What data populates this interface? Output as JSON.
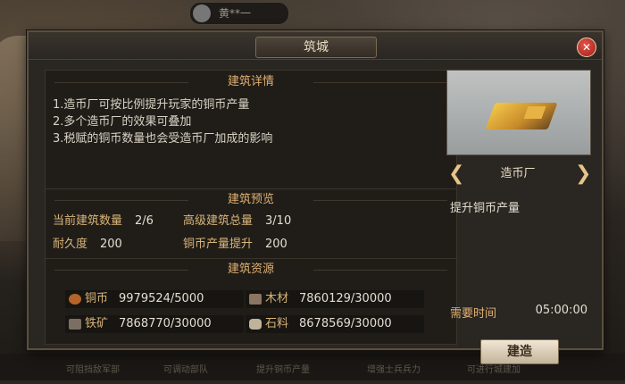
{
  "scene": {
    "player_name": "黄**一",
    "bottom_hints": [
      "可阻挡敌军部",
      "可调动部队",
      "提升铜币产量",
      "增强士兵兵力",
      "可进行城建加"
    ]
  },
  "modal": {
    "title": "筑城",
    "close": "✕"
  },
  "detail": {
    "heading": "建筑详情",
    "lines": [
      "1.造币厂可按比例提升玩家的铜币产量",
      "2.多个造币厂的效果可叠加",
      "3.税赋的铜币数量也会受造币厂加成的影响"
    ]
  },
  "preview": {
    "heading": "建筑预览",
    "items": [
      {
        "label": "当前建筑数量",
        "value": "2/6"
      },
      {
        "label": "高级建筑总量",
        "value": "3/10"
      },
      {
        "label": "耐久度",
        "value": "200"
      },
      {
        "label": "铜币产量提升",
        "value": "200"
      }
    ]
  },
  "resources": {
    "heading": "建筑资源",
    "items": [
      {
        "label": "铜币",
        "value": "9979524/5000",
        "color": "#b5652a"
      },
      {
        "label": "木材",
        "value": "7860129/30000",
        "color": "#8a7560"
      },
      {
        "label": "铁矿",
        "value": "7868770/30000",
        "color": "#7a6f62"
      },
      {
        "label": "石料",
        "value": "8678569/30000",
        "color": "#bfb39c"
      }
    ]
  },
  "building": {
    "name": "造币厂",
    "prev_arrow": "❮",
    "next_arrow": "❯",
    "effect": "提升铜币产量",
    "time_label": "需要时间",
    "time_value": "05:00:00",
    "build_button": "建造"
  }
}
